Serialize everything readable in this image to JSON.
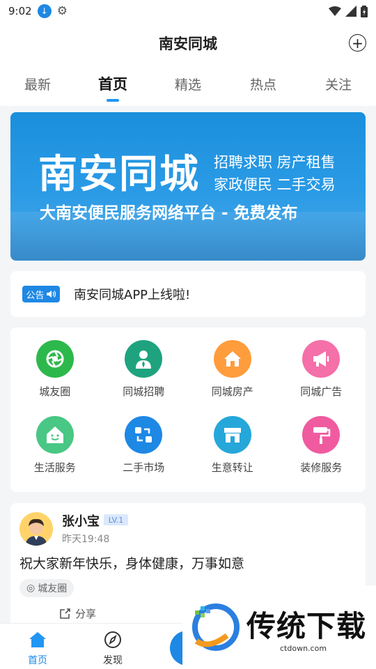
{
  "status_bar": {
    "time": "9:02"
  },
  "app_bar": {
    "title": "南安同城",
    "add_icon": "plus-circle-icon"
  },
  "tabs": [
    {
      "label": "最新",
      "active": false
    },
    {
      "label": "首页",
      "active": true
    },
    {
      "label": "精选",
      "active": false
    },
    {
      "label": "热点",
      "active": false
    },
    {
      "label": "关注",
      "active": false
    }
  ],
  "banner": {
    "title": "南安同城",
    "tags_line1": "招聘求职 房产租售",
    "tags_line2": "家政便民 二手交易",
    "slogan": "大南安便民服务网络平台 - 免费发布"
  },
  "notice": {
    "badge": "公告",
    "text": "南安同城APP上线啦!"
  },
  "services": [
    {
      "label": "城友圈",
      "color": "#2db84c",
      "icon": "aperture-icon"
    },
    {
      "label": "同城招聘",
      "color": "#1fa37f",
      "icon": "person-tie-icon"
    },
    {
      "label": "同城房产",
      "color": "#ff9d3c",
      "icon": "house-icon"
    },
    {
      "label": "同城广告",
      "color": "#f56fa8",
      "icon": "megaphone-icon"
    },
    {
      "label": "生活服务",
      "color": "#49c784",
      "icon": "smile-house-icon"
    },
    {
      "label": "二手市场",
      "color": "#1e88e5",
      "icon": "exchange-icon"
    },
    {
      "label": "生意转让",
      "color": "#26a7d9",
      "icon": "store-icon"
    },
    {
      "label": "装修服务",
      "color": "#f05ba0",
      "icon": "paint-roller-icon"
    }
  ],
  "post": {
    "username": "张小宝",
    "level": "LV.1",
    "time": "昨天19:48",
    "content": "祝大家新年快乐，身体健康，万事如意",
    "tag": "城友圈",
    "share_label": "分享"
  },
  "bottom_nav": {
    "home_label": "首页",
    "discover_label": "发现"
  },
  "watermark": {
    "text": "传统下载",
    "url": "ctdown.com"
  }
}
